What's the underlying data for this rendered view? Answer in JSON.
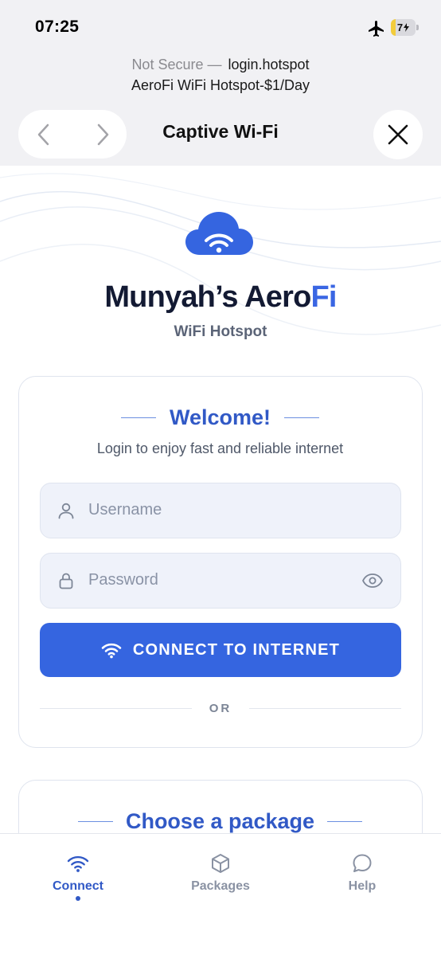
{
  "status_bar": {
    "time": "07:25",
    "battery_level": "7",
    "battery_fraction": 0.07,
    "battery_color": "#f2cc3c"
  },
  "browser": {
    "security_label": "Not Secure —",
    "host": "login.hotspot",
    "page_title": "AeroFi WiFi Hotspot-$1/Day",
    "sheet_title": "Captive Wi-Fi",
    "icons": {
      "back": "chevron-left-icon",
      "forward": "chevron-right-icon",
      "close": "close-icon"
    }
  },
  "brand": {
    "name_main": "Munyah’s Aero",
    "name_accent": "Fi",
    "subtitle": "WiFi Hotspot",
    "logo": "cloud-wifi-icon",
    "accent_color": "#3a66e3",
    "title_color": "#131a33"
  },
  "login": {
    "heading": "Welcome!",
    "subheading": "Login to enjoy fast and reliable internet",
    "username_placeholder": "Username",
    "password_placeholder": "Password",
    "connect_label": "CONNECT TO INTERNET",
    "or_label": "OR",
    "button_color": "#3565e0"
  },
  "packages": {
    "heading": "Choose a package"
  },
  "tabs": [
    {
      "label": "Connect",
      "icon": "wifi-icon",
      "active": true
    },
    {
      "label": "Packages",
      "icon": "box-icon",
      "active": false
    },
    {
      "label": "Help",
      "icon": "chat-bubble-icon",
      "active": false
    }
  ]
}
